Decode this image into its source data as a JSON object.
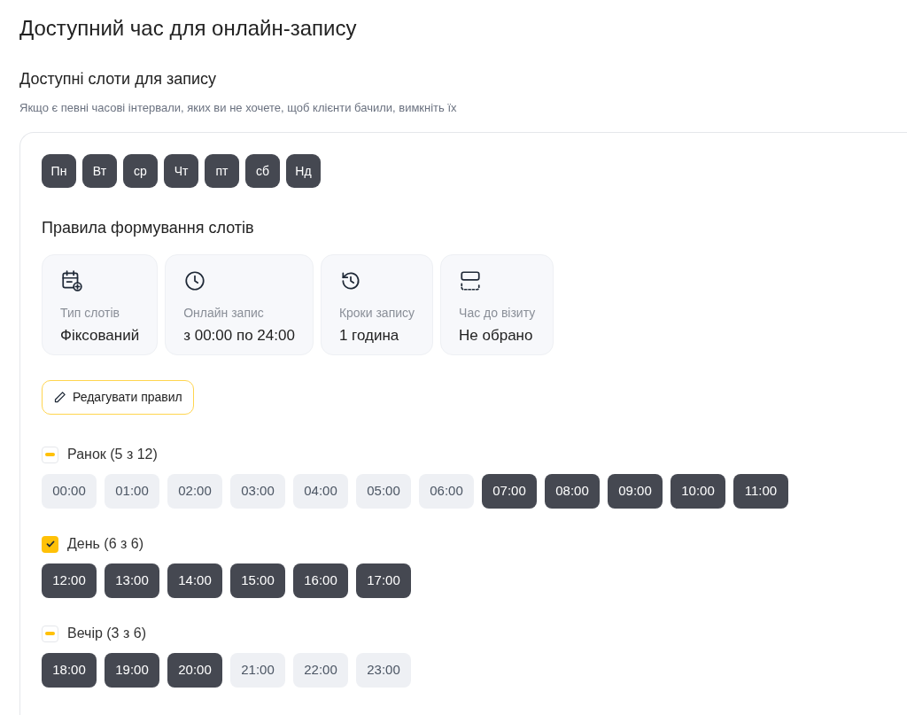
{
  "title": "Доступний час для онлайн-запису",
  "subtitle": "Доступні слоти для запису",
  "hint": "Якщо є певні часові інтервали, яких ви не хочете, щоб клієнти бачили, вимкніть їх",
  "days": [
    {
      "label": "Пн",
      "selected": true
    },
    {
      "label": "Вт",
      "selected": true
    },
    {
      "label": "ср",
      "selected": true
    },
    {
      "label": "Чт",
      "selected": true
    },
    {
      "label": "пт",
      "selected": true
    },
    {
      "label": "сб",
      "selected": true
    },
    {
      "label": "Нд",
      "selected": true
    }
  ],
  "rules_title": "Правила формування слотів",
  "rules": [
    {
      "kind": "calendar",
      "label": "Тип слотів",
      "value": "Фіксований"
    },
    {
      "kind": "clock",
      "label": "Онлайн запис",
      "value": "з 00:00 по 24:00"
    },
    {
      "kind": "history",
      "label": "Кроки запису",
      "value": "1 година"
    },
    {
      "kind": "split",
      "label": "Час до візиту",
      "value": "Не обрано"
    }
  ],
  "edit_button": "Редагувати правил",
  "groups": [
    {
      "label": "Ранок (5 з 12)",
      "checked": true,
      "indeterminate": true,
      "slots": [
        {
          "time": "00:00",
          "selected": false
        },
        {
          "time": "01:00",
          "selected": false
        },
        {
          "time": "02:00",
          "selected": false
        },
        {
          "time": "03:00",
          "selected": false
        },
        {
          "time": "04:00",
          "selected": false
        },
        {
          "time": "05:00",
          "selected": false
        },
        {
          "time": "06:00",
          "selected": false
        },
        {
          "time": "07:00",
          "selected": true
        },
        {
          "time": "08:00",
          "selected": true
        },
        {
          "time": "09:00",
          "selected": true
        },
        {
          "time": "10:00",
          "selected": true
        },
        {
          "time": "11:00",
          "selected": true
        }
      ]
    },
    {
      "label": "День (6 з 6)",
      "checked": true,
      "indeterminate": false,
      "slots": [
        {
          "time": "12:00",
          "selected": true
        },
        {
          "time": "13:00",
          "selected": true
        },
        {
          "time": "14:00",
          "selected": true
        },
        {
          "time": "15:00",
          "selected": true
        },
        {
          "time": "16:00",
          "selected": true
        },
        {
          "time": "17:00",
          "selected": true
        }
      ]
    },
    {
      "label": "Вечір (3 з 6)",
      "checked": true,
      "indeterminate": true,
      "slots": [
        {
          "time": "18:00",
          "selected": true
        },
        {
          "time": "19:00",
          "selected": true
        },
        {
          "time": "20:00",
          "selected": true
        },
        {
          "time": "21:00",
          "selected": false
        },
        {
          "time": "22:00",
          "selected": false
        },
        {
          "time": "23:00",
          "selected": false
        }
      ]
    }
  ]
}
